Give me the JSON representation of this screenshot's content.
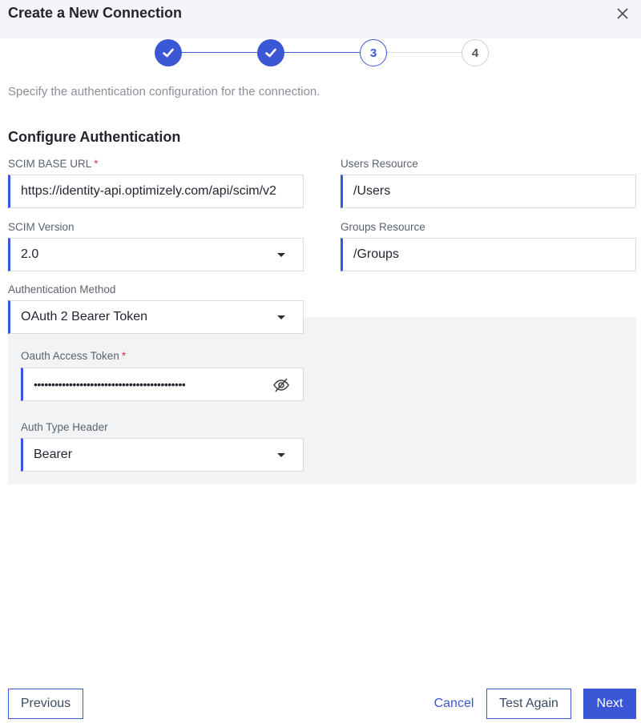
{
  "dialog": {
    "title": "Create a New Connection",
    "close_icon": "close-icon"
  },
  "stepper": {
    "steps": [
      {
        "label": "",
        "state": "complete",
        "icon": "checkmark-icon"
      },
      {
        "label": "",
        "state": "complete",
        "icon": "checkmark-icon"
      },
      {
        "label": "3",
        "state": "current"
      },
      {
        "label": "4",
        "state": "upcoming"
      }
    ]
  },
  "subtitle": "Specify the authentication configuration for the connection.",
  "section_title": "Configure Authentication",
  "form": {
    "scim_base_url": {
      "label": "SCIM BASE URL",
      "required": "*",
      "value": "https://identity-api.optimizely.com/api/scim/v2"
    },
    "users_resource": {
      "label": "Users Resource",
      "value": "/Users"
    },
    "scim_version": {
      "label": "SCIM Version",
      "value": "2.0"
    },
    "groups_resource": {
      "label": "Groups Resource",
      "value": "/Groups"
    },
    "auth_method": {
      "label": "Authentication Method",
      "value": "OAuth 2 Bearer Token"
    },
    "oauth_token": {
      "label": "Oauth Access Token",
      "required": "*",
      "value": "•••••••••••••••••••••••••••••••••••••••••••",
      "toggle_icon": "eye-off-icon"
    },
    "auth_type_header": {
      "label": "Auth Type Header",
      "value": "Bearer"
    }
  },
  "footer": {
    "previous": "Previous",
    "cancel": "Cancel",
    "test_again": "Test Again",
    "next": "Next"
  },
  "colors": {
    "accent": "#3b57d6",
    "required": "#d0353f",
    "header_bg": "#f3f5f8",
    "panel_bg": "#f2f3f4"
  }
}
